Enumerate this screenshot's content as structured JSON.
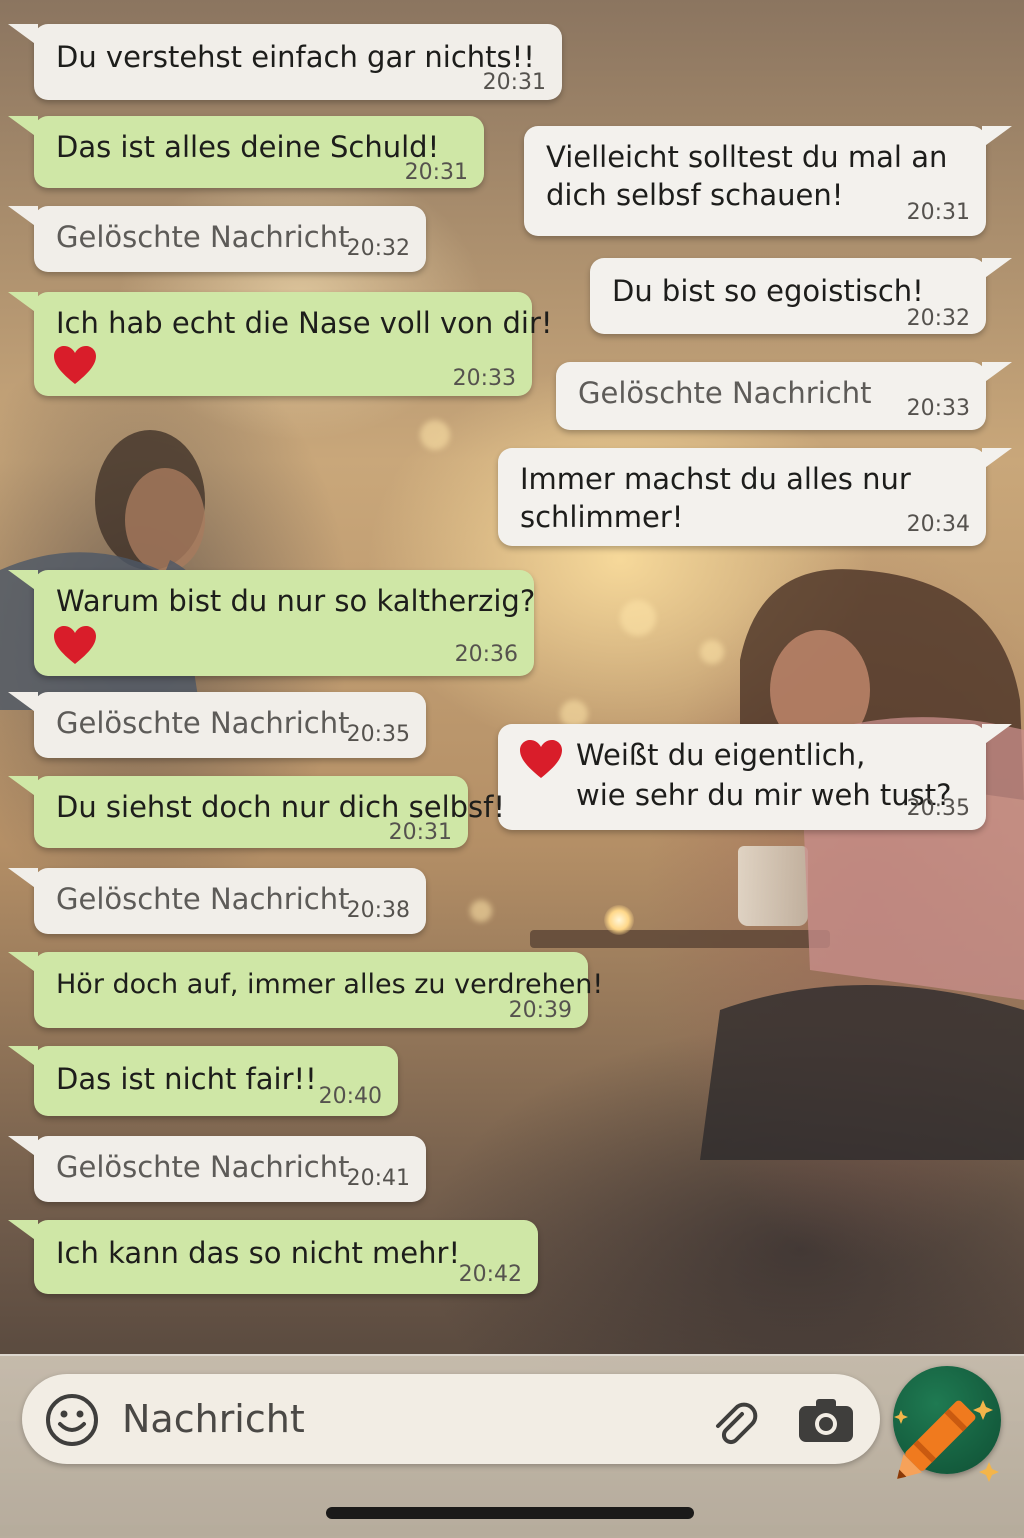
{
  "messages": [
    {
      "id": "m1",
      "side": "left",
      "style": "white",
      "lines": [
        "Du verstehst einfach gar nichts!!"
      ],
      "time": "20:31"
    },
    {
      "id": "m2",
      "side": "left",
      "style": "green",
      "lines": [
        "Das ist alles deine Schuld!"
      ],
      "time": "20:31"
    },
    {
      "id": "m3",
      "side": "right",
      "style": "white",
      "lines": [
        "Vielleicht solltest du mal an",
        "dich selbsf schauen!"
      ],
      "time": "20:31"
    },
    {
      "id": "m4",
      "side": "left",
      "style": "deleted",
      "lines": [
        "Gelöschte Nachricht"
      ],
      "time": "20:32"
    },
    {
      "id": "m5",
      "side": "right",
      "style": "white",
      "lines": [
        "Du bist so egoistisch!"
      ],
      "time": "20:32"
    },
    {
      "id": "m6",
      "side": "left",
      "style": "green",
      "lines": [
        "Ich hab echt die Nase voll von dir!"
      ],
      "heart": true,
      "time": "20:33"
    },
    {
      "id": "m7",
      "side": "right",
      "style": "deleted",
      "lines": [
        "Gelöschte Nachricht"
      ],
      "time": "20:33"
    },
    {
      "id": "m8",
      "side": "right",
      "style": "white",
      "lines": [
        "Immer machst du alles nur",
        "schlimmer!"
      ],
      "time": "20:34"
    },
    {
      "id": "m9",
      "side": "left",
      "style": "green",
      "lines": [
        "Warum bist du nur so kaltherzig?"
      ],
      "heart": true,
      "time": "20:36"
    },
    {
      "id": "m10",
      "side": "left",
      "style": "deleted",
      "lines": [
        "Gelöschte Nachricht"
      ],
      "time": "20:35"
    },
    {
      "id": "m11",
      "side": "right",
      "style": "white",
      "lines": [
        "Weißt du eigentlich,",
        "wie sehr du mir weh tust?"
      ],
      "heart": true,
      "time": "20:35"
    },
    {
      "id": "m12",
      "side": "left",
      "style": "green",
      "lines": [
        "Du siehst doch nur dich selbsf!"
      ],
      "time": "20:31"
    },
    {
      "id": "m13",
      "side": "left",
      "style": "deleted",
      "lines": [
        "Gelöschte Nachricht"
      ],
      "time": "20:38"
    },
    {
      "id": "m14",
      "side": "left",
      "style": "green",
      "lines": [
        "Hör doch auf, immer alles zu verdrehen!"
      ],
      "time": "20:39"
    },
    {
      "id": "m15",
      "side": "left",
      "style": "green",
      "lines": [
        "Das ist nicht fair!!"
      ],
      "time": "20:40"
    },
    {
      "id": "m16",
      "side": "left",
      "style": "deleted",
      "lines": [
        "Gelöschte Nachricht"
      ],
      "time": "20:41"
    },
    {
      "id": "m17",
      "side": "left",
      "style": "green",
      "lines": [
        "Ich kann das so nicht mehr!"
      ],
      "time": "20:42"
    }
  ],
  "composer": {
    "placeholder": "Nachricht",
    "emoji_icon": "smiley-icon",
    "attach_icon": "paperclip-icon",
    "camera_icon": "camera-icon",
    "send_icon": "crayon-icon"
  },
  "colors": {
    "green_bubble": "#cfe7a6",
    "white_bubble": "#f1eee9",
    "send_button": "#1f7a52",
    "heart": "#d91d2a"
  }
}
